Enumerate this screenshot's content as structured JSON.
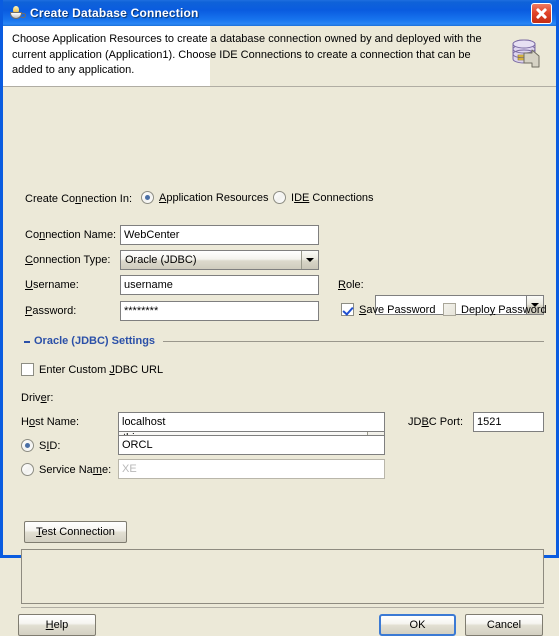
{
  "window": {
    "title": "Create Database Connection",
    "title_icon": "java-coffee-cup-icon",
    "close_label": "×"
  },
  "header": {
    "description": "Choose Application Resources to create a database connection owned by and deployed with the current application (Application1). Choose IDE Connections to create a connection that can be added to any application.",
    "icon": "database-connection-icon"
  },
  "form": {
    "create_in_label": "Create Connection In:",
    "create_in_options": [
      {
        "label": "Application Resources",
        "mnemonic": "A",
        "selected": true
      },
      {
        "label": "IDE Connections",
        "mnemonic": "DE",
        "selected": false
      }
    ],
    "connection_name_label": "Connection Name:",
    "connection_name_value": "WebCenter",
    "connection_type_label": "Connection Type:",
    "connection_type_value": "Oracle (JDBC)",
    "username_label": "Username:",
    "username_value": "username",
    "password_label": "Password:",
    "password_value": "********",
    "role_label": "Role:",
    "role_value": "",
    "save_password_label": "Save Password",
    "save_password_checked": true,
    "deploy_password_label": "Deploy Password",
    "deploy_password_checked": false,
    "deploy_password_disabled": true
  },
  "group": {
    "title": "Oracle (JDBC) Settings",
    "custom_url_label": "Enter Custom JDBC URL",
    "custom_url_checked": false,
    "driver_label": "Driver:",
    "driver_value": "thin",
    "host_label": "Host Name:",
    "host_value": "localhost",
    "port_label": "JDBC Port:",
    "port_value": "1521",
    "sid_label": "SID:",
    "sid_value": "ORCL",
    "sid_selected": true,
    "service_name_label": "Service Name:",
    "service_name_placeholder": "XE",
    "service_name_selected": false
  },
  "actions": {
    "test_connection_label": "Test Connection",
    "status_text": "",
    "help_label": "Help",
    "ok_label": "OK",
    "cancel_label": "Cancel"
  },
  "colors": {
    "titlebar_blue": "#0a5ce0",
    "window_border": "#0a5ce0",
    "dialog_bg": "#ece9d8",
    "group_title": "#2b50a8",
    "close_red": "#c32c12",
    "focus_blue": "#3b7ad4"
  }
}
